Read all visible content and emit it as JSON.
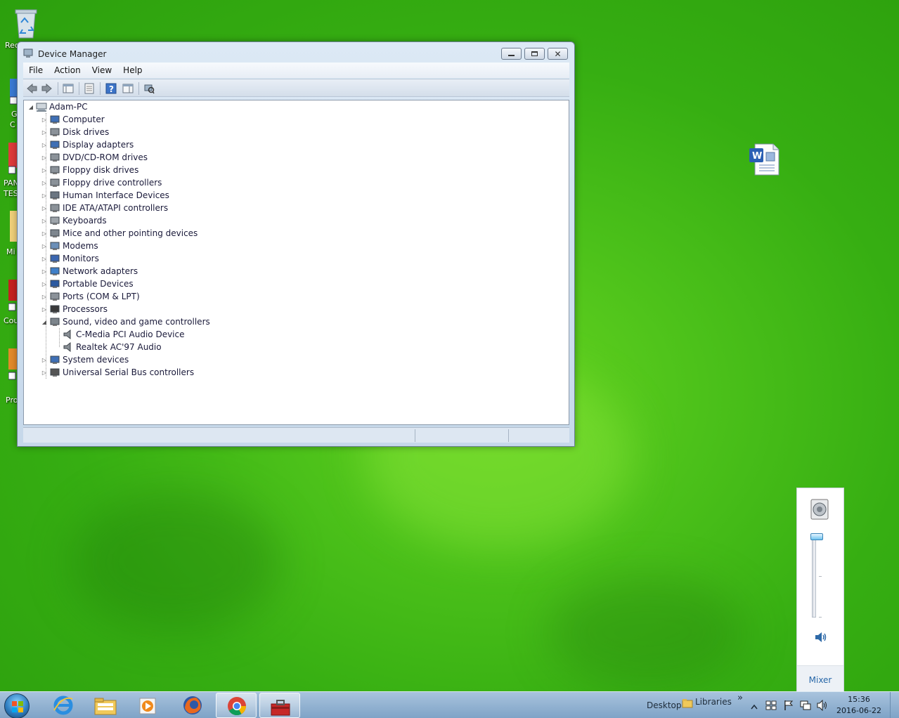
{
  "desktop": {
    "icons": [
      {
        "label": "Rec"
      },
      {
        "label": "G"
      },
      {
        "label": "C"
      },
      {
        "label": "PAN"
      },
      {
        "label": "TES"
      },
      {
        "label": "Mi"
      },
      {
        "label": "Cou"
      },
      {
        "label": "Pro"
      }
    ]
  },
  "window": {
    "title": "Device Manager",
    "menu": [
      "File",
      "Action",
      "View",
      "Help"
    ],
    "tree": {
      "root": "Adam-PC",
      "categories": [
        {
          "label": "Computer",
          "expanded": false
        },
        {
          "label": "Disk drives",
          "expanded": false
        },
        {
          "label": "Display adapters",
          "expanded": false
        },
        {
          "label": "DVD/CD-ROM drives",
          "expanded": false
        },
        {
          "label": "Floppy disk drives",
          "expanded": false
        },
        {
          "label": "Floppy drive controllers",
          "expanded": false
        },
        {
          "label": "Human Interface Devices",
          "expanded": false
        },
        {
          "label": "IDE ATA/ATAPI controllers",
          "expanded": false
        },
        {
          "label": "Keyboards",
          "expanded": false
        },
        {
          "label": "Mice and other pointing devices",
          "expanded": false
        },
        {
          "label": "Modems",
          "expanded": false
        },
        {
          "label": "Monitors",
          "expanded": false
        },
        {
          "label": "Network adapters",
          "expanded": false
        },
        {
          "label": "Portable Devices",
          "expanded": false
        },
        {
          "label": "Ports (COM & LPT)",
          "expanded": false
        },
        {
          "label": "Processors",
          "expanded": false
        },
        {
          "label": "Sound, video and game controllers",
          "expanded": true,
          "children": [
            "C-Media PCI Audio Device",
            "Realtek AC'97 Audio"
          ]
        },
        {
          "label": "System devices",
          "expanded": false
        },
        {
          "label": "Universal Serial Bus controllers",
          "expanded": false
        }
      ]
    }
  },
  "volume": {
    "level": 1.0,
    "mixer_label": "Mixer"
  },
  "taskbar": {
    "apps": [
      "internet-explorer",
      "windows-explorer",
      "media-player",
      "firefox",
      "chrome",
      "toolbox"
    ],
    "toolbars": {
      "desktop_label": "Desktop",
      "libraries_label": "Libraries",
      "overflow": "»"
    },
    "clock": {
      "time": "15:36",
      "date": "2016-06-22"
    }
  }
}
